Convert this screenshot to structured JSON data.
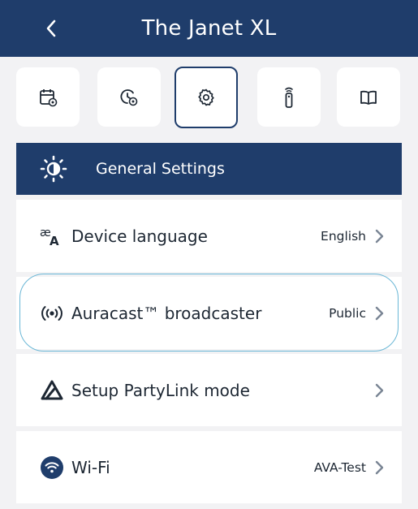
{
  "header": {
    "title": "The Janet XL"
  },
  "tabs": [
    {
      "icon": "calendar-settings-icon",
      "active": false
    },
    {
      "icon": "clock-settings-icon",
      "active": false
    },
    {
      "icon": "gear-icon",
      "active": true
    },
    {
      "icon": "remote-control-icon",
      "active": false
    },
    {
      "icon": "book-icon",
      "active": false
    }
  ],
  "section": {
    "title": "General Settings",
    "icon": "sun-icon"
  },
  "settings": [
    {
      "label": "Device language",
      "value": "English",
      "icon": "language-icon"
    },
    {
      "label": "Auracast™ broadcaster",
      "value": "Public",
      "icon": "broadcast-icon"
    },
    {
      "label": "Setup PartyLink mode",
      "value": "",
      "icon": "partylink-icon"
    },
    {
      "label": "Wi-Fi",
      "value": "AVA-Test",
      "icon": "wifi-icon"
    }
  ],
  "colors": {
    "primary": "#1f3d6b",
    "background": "#f2f2f4",
    "highlight": "#6bb7d6",
    "chevron": "#7a8594"
  }
}
